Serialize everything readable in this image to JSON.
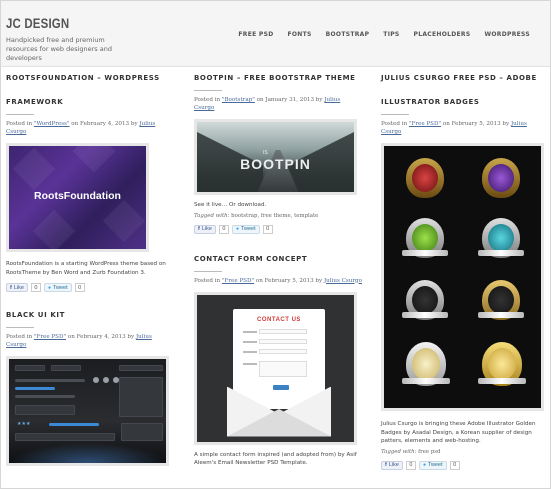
{
  "site": {
    "logo": "JC DESIGN",
    "tagline": "Handpicked free and premium resources for web designers and developers"
  },
  "nav": [
    "FREE PSD",
    "FONTS",
    "BOOTSTRAP",
    "TIPS",
    "PLACEHOLDERS",
    "WORDPRESS"
  ],
  "posts": {
    "roots": {
      "title_line1": "ROOTSFOUNDATION – WORDPRESS",
      "title_line2": "FRAMEWORK",
      "posted_in": "Posted in",
      "category": "\"WordPress\"",
      "date": "on February 4, 2013 by",
      "author": "Julius Csurgo",
      "image_text": "RootsFoundation",
      "excerpt": "RootsFoundation is a starting WordPress theme based on RootsTheme by Ben Word and Zurb Foundation 3.",
      "like_label": "Like",
      "like_count": "0",
      "tweet_label": "Tweet",
      "tweet_count": "0"
    },
    "blackui": {
      "title": "BLACK UI KIT",
      "posted_in": "Posted in",
      "category": "\"Free PSD\"",
      "date": "on February 4, 2013 by",
      "author": "Julius Csurgo"
    },
    "bootpin": {
      "title": "BOOTPIN – FREE BOOTSTRAP THEME",
      "posted_in": "Posted in",
      "category": "\"Bootstrap\"",
      "date": "on January 31, 2013 by",
      "author": "Julius Csurgo",
      "image_text": "BOOTPIN",
      "image_small": "IS",
      "excerpt": "See it live… Or download.",
      "tagged_label": "Tagged with:",
      "tags": "bootstrap, free theme, template",
      "like_label": "Like",
      "like_count": "0",
      "tweet_label": "Tweet",
      "tweet_count": "0"
    },
    "contact": {
      "title": "CONTACT FORM CONCEPT",
      "posted_in": "Posted in",
      "category": "\"Free PSD\"",
      "date": "on February 5, 2013 by",
      "author": "Julius Csurgo",
      "image_text": "CONTACT US",
      "excerpt": "A simple contact form inspired (and adopted from) by Asif Aleem's Email Newsletter PSD Template."
    },
    "badges": {
      "title_line1": "JULIUS CSURGO FREE PSD – ADOBE",
      "title_line2": "ILLUSTRATOR BADGES",
      "posted_in": "Posted in",
      "category": "\"Free PSD\"",
      "date": "on February 5, 2013 by",
      "author": "Julius Csurgo",
      "excerpt": "Julius Csurgo is bringing these Adobe Illustrator Golden Badges by Asadal Design, a Korean supplier of design patters, elements and web-hosting.",
      "tagged_label": "Tagged with:",
      "tags": "free psd",
      "like_label": "Like",
      "like_count": "0",
      "tweet_label": "Tweet",
      "tweet_count": "0"
    }
  },
  "colors": {
    "header_bg": "#f5f5f5",
    "link": "#4a6a9a",
    "facebook": "#3b5998",
    "twitter": "#2aa3ef"
  }
}
